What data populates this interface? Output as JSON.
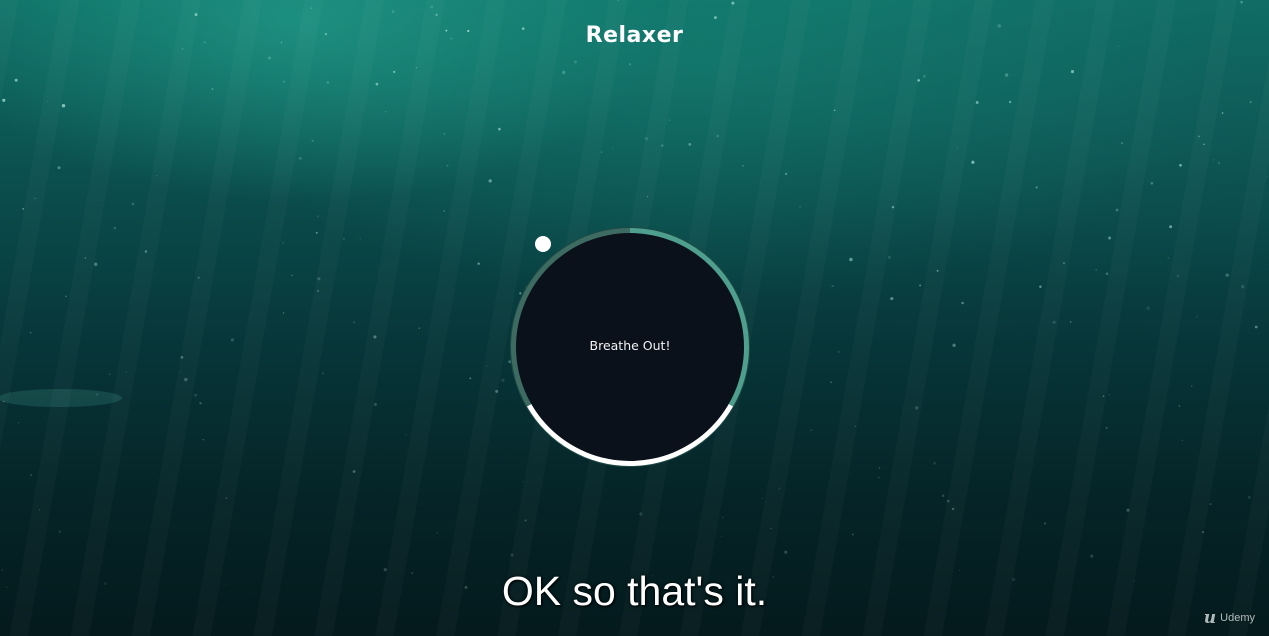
{
  "app": {
    "title": "Relaxer"
  },
  "breath": {
    "instruction": "Breathe Out!",
    "phase_arcs": [
      {
        "phase": "breathe-in",
        "from_deg": 0,
        "to_deg": 120,
        "color": "#4f9f8e"
      },
      {
        "phase": "hold",
        "from_deg": 120,
        "to_deg": 240,
        "color": "#ffffff"
      },
      {
        "phase": "breathe-out",
        "from_deg": 240,
        "to_deg": 360,
        "color": "#3d6b62"
      }
    ],
    "pointer_deg": 320,
    "inner_color": "#0a111b"
  },
  "subtitle": {
    "text": "OK so that's it."
  },
  "watermark": {
    "mark": "u",
    "label": "Udemy"
  }
}
